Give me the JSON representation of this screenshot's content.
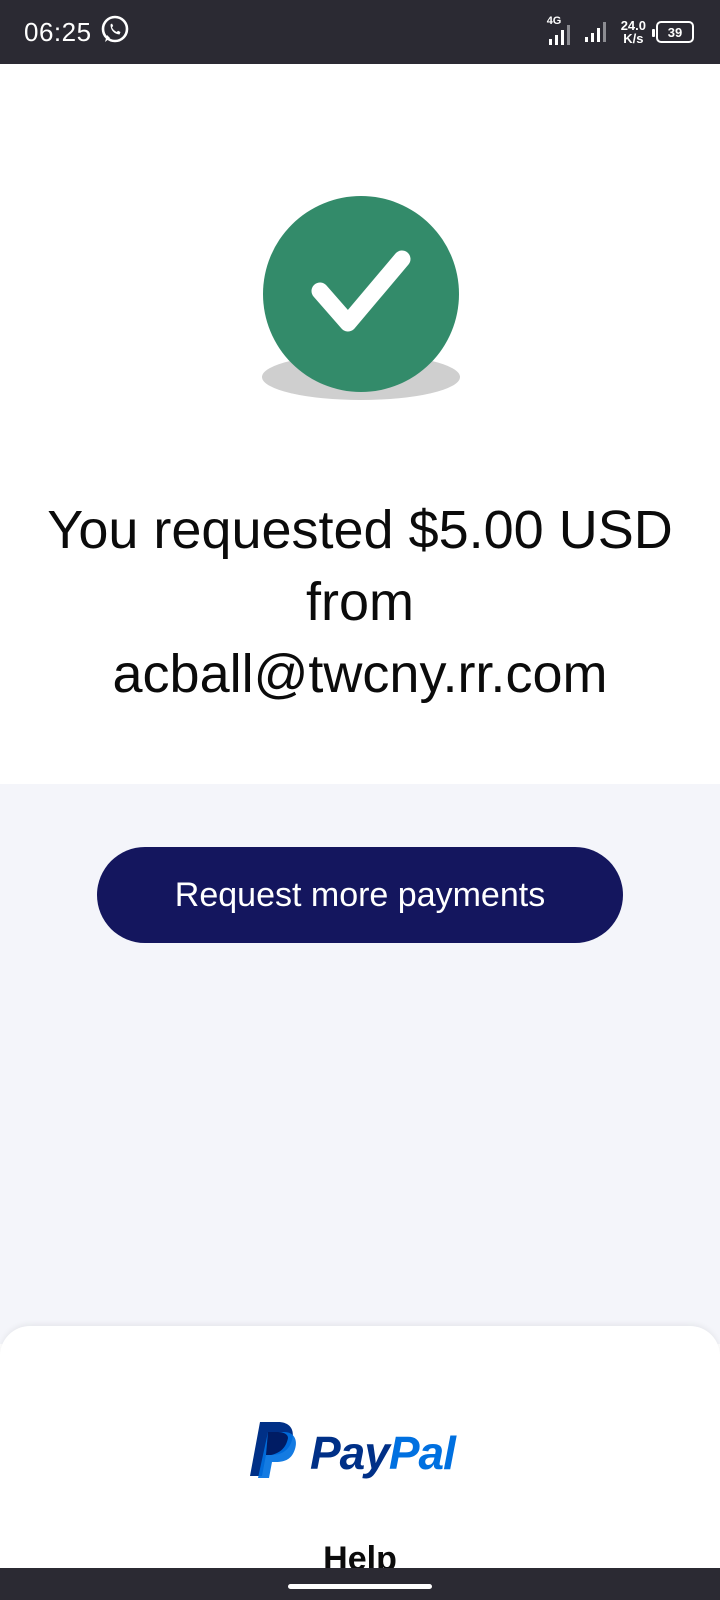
{
  "status_bar": {
    "time": "06:25",
    "network_type": "4G",
    "net_speed_value": "24.0",
    "net_speed_unit": "K/s",
    "battery": "39",
    "icons": [
      "whatsapp-icon",
      "signal-4g-icon",
      "signal-icon",
      "battery-icon"
    ]
  },
  "success": {
    "icon": "check-circle-icon",
    "message_line1": "You requested $5.00 USD",
    "message_line2": "from",
    "message_line3": "acball@twcny.rr.com",
    "accent_color": "#338b6a"
  },
  "actions": {
    "request_more_label": "Request more payments",
    "button_color": "#14165e"
  },
  "footer": {
    "logo_pay": "Pay",
    "logo_pal": "Pal",
    "help_label": "Help"
  }
}
